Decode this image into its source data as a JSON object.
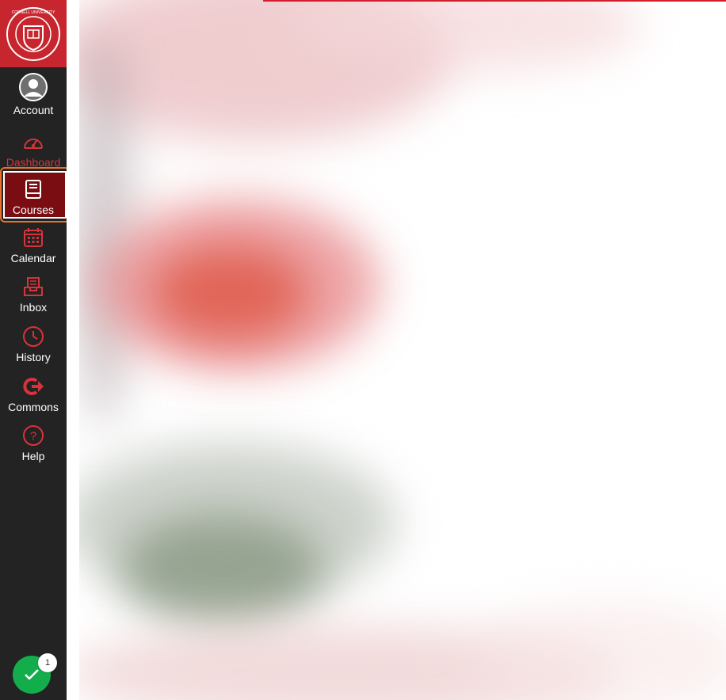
{
  "nav": {
    "logo_text": "CORNELL UNIVERSITY FOUNDED A.D. 1865",
    "items": [
      {
        "id": "account",
        "label": "Account",
        "icon": "avatar-icon"
      },
      {
        "id": "dashboard",
        "label": "Dashboard",
        "icon": "dashboard-icon",
        "active": true
      },
      {
        "id": "courses",
        "label": "Courses",
        "icon": "courses-book-icon",
        "focused": true
      },
      {
        "id": "calendar",
        "label": "Calendar",
        "icon": "calendar-icon"
      },
      {
        "id": "inbox",
        "label": "Inbox",
        "icon": "inbox-icon"
      },
      {
        "id": "history",
        "label": "History",
        "icon": "clock-icon"
      },
      {
        "id": "commons",
        "label": "Commons",
        "icon": "commons-icon"
      },
      {
        "id": "help",
        "label": "Help",
        "icon": "help-icon"
      }
    ]
  },
  "todo": {
    "badge_count": "1",
    "icon": "check-icon"
  },
  "colors": {
    "brand": "#c8262e",
    "nav_bg": "#232323",
    "focus": "#e8702a",
    "todo": "#13ad4c"
  }
}
